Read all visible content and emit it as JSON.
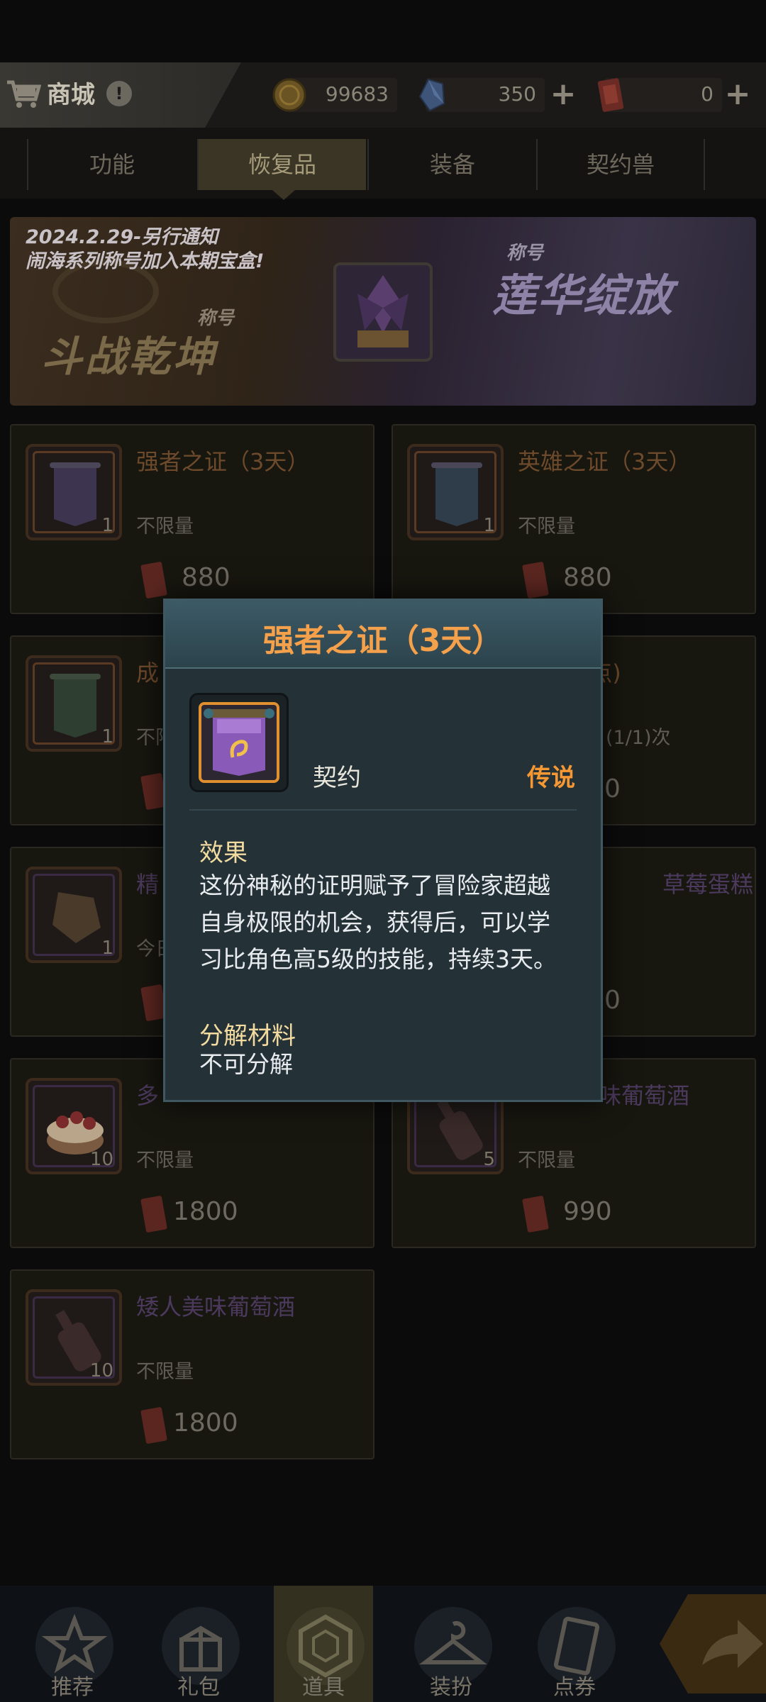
{
  "header": {
    "shop_title": "商城",
    "info_mark": "!",
    "gold": "99683",
    "gems": "350",
    "tickets": "0",
    "plus": "+"
  },
  "category_tabs": [
    {
      "label": "功能",
      "active": false
    },
    {
      "label": "恢复品",
      "active": true
    },
    {
      "label": "装备",
      "active": false
    },
    {
      "label": "契约兽",
      "active": false
    }
  ],
  "banner": {
    "notice_line1": "2024.2.29-另行通知",
    "notice_line2": "闹海系列称号加入本期宝盒!",
    "left_tag": "称号",
    "left_title": "斗战乾坤",
    "right_tag": "称号",
    "right_title": "莲华绽放"
  },
  "items": [
    {
      "name": "强者之证（3天）",
      "limit": "不限量",
      "price": "880",
      "qty": "1"
    },
    {
      "name": "英雄之证（3天）",
      "limit": "不限量",
      "price": "880",
      "qty": "1"
    },
    {
      "name": "成",
      "limit": "不限",
      "price": "",
      "qty": "1"
    },
    {
      "name": "秘药(40点)",
      "limit": "(1/1)次",
      "price": "0",
      "qty": ""
    },
    {
      "name": "精",
      "limit": "今日",
      "price": "",
      "qty": "1"
    },
    {
      "name": "草莓蛋糕",
      "limit": "",
      "price": "0",
      "qty": ""
    },
    {
      "name": "多",
      "limit": "不限量",
      "price": "1800",
      "qty": "10"
    },
    {
      "name": "味葡萄酒",
      "limit": "不限量",
      "price": "990",
      "qty": "5"
    },
    {
      "name": "矮人美味葡萄酒",
      "limit": "不限量",
      "price": "1800",
      "qty": "10"
    }
  ],
  "bottom_nav": [
    {
      "label": "推荐",
      "active": false
    },
    {
      "label": "礼包",
      "active": false
    },
    {
      "label": "道具",
      "active": true
    },
    {
      "label": "装扮",
      "active": false
    },
    {
      "label": "点券",
      "active": false
    }
  ],
  "modal": {
    "title": "强者之证（3天）",
    "item_type": "契约",
    "rarity": "传说",
    "effect_title": "效果",
    "effect_text": "这份神秘的证明赋予了冒险家超越自身极限的机会，获得后，可以学习比角色高5级的技能，持续3天。",
    "decompose_title": "分解材料",
    "decompose_text": "不可分解"
  },
  "colors": {
    "rarity_legendary": "#f59833",
    "modal_title": "#f5a04a",
    "section_title": "#f3dba0",
    "modal_bg": "#243238"
  }
}
